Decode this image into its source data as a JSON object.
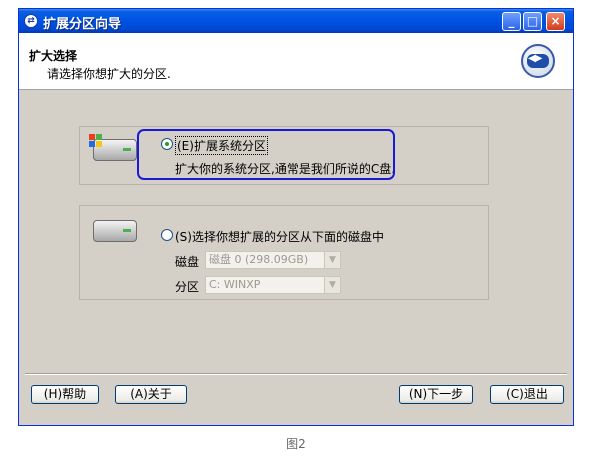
{
  "window": {
    "title": "扩展分区向导",
    "min_symbol": "_",
    "max_symbol": "□",
    "close_symbol": "×"
  },
  "header": {
    "title": "扩大选择",
    "subtitle": "请选择你想扩大的分区."
  },
  "option_system": {
    "label": "(E)扩展系统分区",
    "description": "扩大你的系统分区,通常是我们所说的C盘.",
    "selected": true
  },
  "option_disk": {
    "label": "(S)选择你想扩展的分区从下面的磁盘中",
    "selected": false,
    "disk_label": "磁盘",
    "disk_value": "磁盘 0 (298.09GB)",
    "partition_label": "分区",
    "partition_value": "C: WINXP"
  },
  "buttons": {
    "help": "(H)帮助",
    "about": "(A)关于",
    "next": "(N)下一步",
    "exit": "(C)退出"
  },
  "caption": "图2",
  "colors": {
    "highlight_border": "#1a1ad6",
    "titlebar": "#0055e5",
    "dialog_bg": "#d4d0c8"
  },
  "icons": {
    "title": "wizard-icon",
    "header": "extend-arrows-icon",
    "drive_system": "windows-drive-icon",
    "drive_generic": "hard-drive-icon"
  }
}
